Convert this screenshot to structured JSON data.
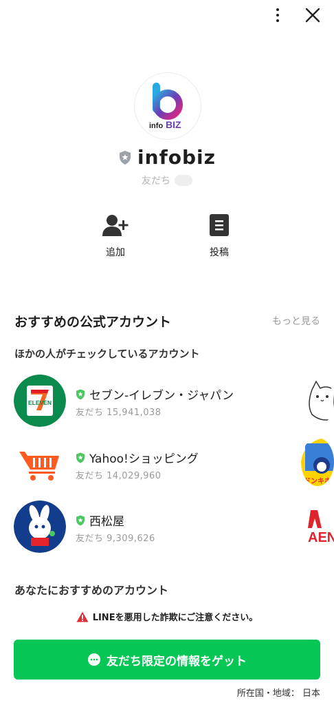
{
  "profile": {
    "name": "infobiz",
    "friends_label": "友だち",
    "logo_text_info": "info",
    "logo_text_biz": "BIZ"
  },
  "actions": [
    {
      "label": "追加",
      "icon": "add-friend-icon"
    },
    {
      "label": "投稿",
      "icon": "post-icon"
    }
  ],
  "recommended": {
    "title": "おすすめの公式アカウント",
    "more_label": "もっと見る",
    "subtitle": "ほかの人がチェックしているアカウント",
    "accounts": [
      {
        "name": "セブン-イレブン・ジャパン",
        "count": "友だち 15,941,038",
        "logo_text": "ELEVEN"
      },
      {
        "name": "Yahoo!ショッピング",
        "count": "友だち 14,029,960"
      },
      {
        "name": "西松屋",
        "count": "友だち 9,309,626"
      }
    ],
    "peek_texts": [
      "ドンキホ",
      "AEN"
    ]
  },
  "recommended_for_you": {
    "title": "あなたにおすすめのアカウント"
  },
  "warning": {
    "text": "LINEを悪用した詐欺にご注意ください。"
  },
  "cta": {
    "label": "友だち限定の情報をゲット"
  },
  "footer": {
    "country": "所在国・地域： 日本"
  },
  "colors": {
    "line_green": "#06c755",
    "verified_green": "#4cc764",
    "warning_red": "#e0313a"
  }
}
